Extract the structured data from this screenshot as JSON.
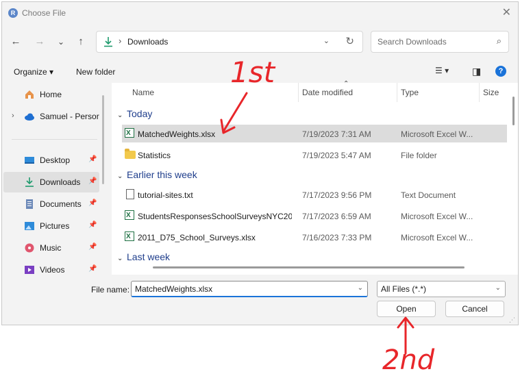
{
  "window": {
    "title": "Choose File",
    "app_icon_letter": "R",
    "close_glyph": "✕"
  },
  "nav": {
    "back_glyph": "←",
    "forward_glyph": "→",
    "recent_glyph": "⌄",
    "up_glyph": "↑",
    "breadcrumb": "Downloads",
    "breadcrumb_sep": "›",
    "refresh_glyph": "↻",
    "search_placeholder": "Search Downloads",
    "search_glyph": "⌕"
  },
  "toolbar": {
    "organize": "Organize ▾",
    "new_folder": "New folder",
    "view_glyph": "☰ ▾",
    "preview_glyph": "◨",
    "help_glyph": "?"
  },
  "sidebar": {
    "items": [
      {
        "label": "Home",
        "icon": "home-icon",
        "pinned": false
      },
      {
        "label": "Samuel - Persor",
        "icon": "onedrive-icon",
        "pinned": false,
        "expand": "›"
      },
      {
        "label": "Desktop",
        "icon": "desktop-icon",
        "pinned": true
      },
      {
        "label": "Downloads",
        "icon": "download-icon",
        "pinned": true,
        "active": true
      },
      {
        "label": "Documents",
        "icon": "documents-icon",
        "pinned": true
      },
      {
        "label": "Pictures",
        "icon": "pictures-icon",
        "pinned": true
      },
      {
        "label": "Music",
        "icon": "music-icon",
        "pinned": true
      },
      {
        "label": "Videos",
        "icon": "videos-icon",
        "pinned": true
      }
    ],
    "pin_glyph": "📌"
  },
  "columns": {
    "name": "Name",
    "date": "Date modified",
    "type": "Type",
    "size": "Size",
    "sort_glyph": "⌃"
  },
  "groups": {
    "today": "Today",
    "earlier": "Earlier this week",
    "last_week": "Last week",
    "chevron": "⌄"
  },
  "files": [
    {
      "name": "MatchedWeights.xlsx",
      "date": "7/19/2023 7:31 AM",
      "type": "Microsoft Excel W...",
      "icon": "excel-icon",
      "selected": true
    },
    {
      "name": "Statistics",
      "date": "7/19/2023 5:47 AM",
      "type": "File folder",
      "icon": "folder-icon"
    },
    {
      "name": "tutorial-sites.txt",
      "date": "7/17/2023 9:56 PM",
      "type": "Text Document",
      "icon": "text-file-icon"
    },
    {
      "name": "StudentsResponsesSchoolSurveysNYC20...",
      "date": "7/17/2023 6:59 AM",
      "type": "Microsoft Excel W...",
      "icon": "excel-icon"
    },
    {
      "name": "2011_D75_School_Surveys.xlsx",
      "date": "7/16/2023 7:33 PM",
      "type": "Microsoft Excel W...",
      "icon": "excel-icon"
    }
  ],
  "bottom": {
    "file_name_label": "File name:",
    "file_name_value": "MatchedWeights.xlsx",
    "file_type_value": "All Files (*.*)",
    "dropdown_glyph": "⌄",
    "open_label": "Open",
    "cancel_label": "Cancel"
  },
  "annotations": {
    "first": "1st",
    "second": "2nd"
  },
  "colors": {
    "accent": "#1a73d9",
    "annotation": "#e8262a",
    "excel": "#1d6f42",
    "group_header": "#1f3e8c"
  }
}
